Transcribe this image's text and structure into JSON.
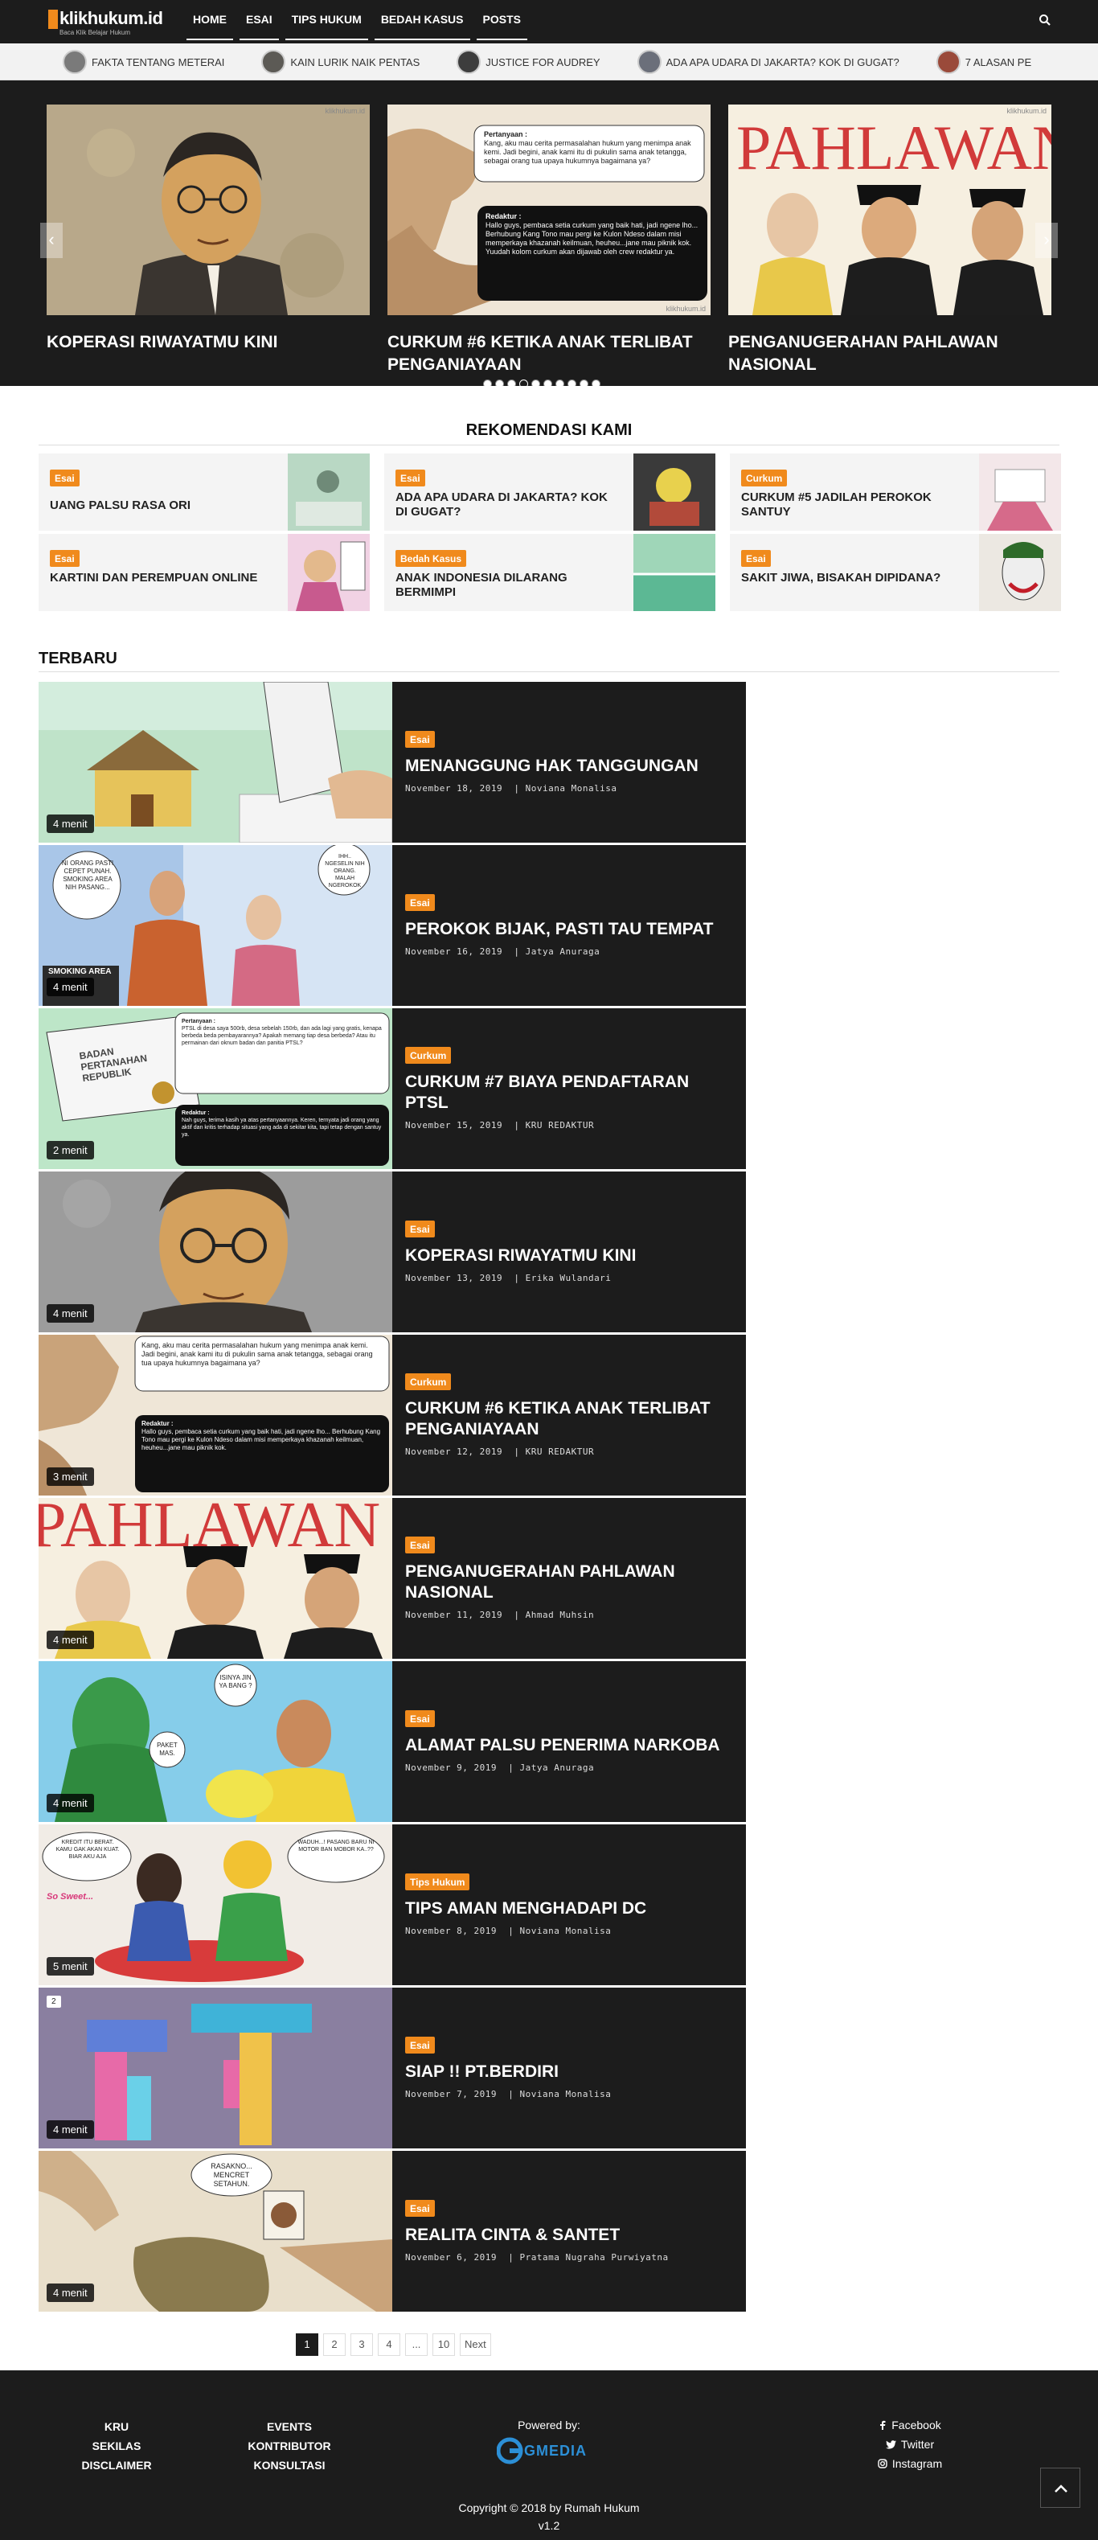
{
  "brand": {
    "logo": "klikhukum.id",
    "tagline": "Baca Klik Belajar Hukum",
    "accent": "#f08a1c",
    "dark": "#1c1c1c"
  },
  "nav": {
    "items": [
      "HOME",
      "ESAI",
      "TIPS HUKUM",
      "BEDAH KASUS",
      "POSTS"
    ],
    "search_icon": "search-icon"
  },
  "ticker": {
    "items": [
      "Fakta Tentang Meterai",
      "Kain Lurik Naik Pentas",
      "Justice for Audrey",
      "Ada Apa Udara di Jakarta? Kok di Gugat?",
      "7 Alasan Pe"
    ]
  },
  "slider": {
    "watermark": "klikhukum.id",
    "slides": [
      {
        "title": "Koperasi Riwayatmu Kini"
      },
      {
        "title": "Curkum #6 Ketika Anak Terlibat Penganiayaan",
        "q_label": "Pertanyaan :",
        "q_text": "Kang, aku mau cerita permasalahan hukum yang menimpa anak kemi. Jadi begini, anak kami itu di pukulin sama anak tetangga, sebagai orang tua upaya hukumnya bagaimana ya?",
        "a_label": "Redaktur :",
        "a_text": "Hallo guys, pembaca setia curkum yang baik hati, jadi ngene lho... Berhubung Kang Tono mau pergi ke Kulon Ndeso dalam misi memperkaya khazanah keilmuan, heuheu...jane mau piknik kok. Yuudah kolom curkum akan dijawab oleh crew redaktur ya."
      },
      {
        "title": "Penganugerahan Pahlawan Nasional",
        "art_text": "PAHLAWAN"
      }
    ],
    "dots": 10,
    "active_dot": 4,
    "prev_icon": "chevron-left-icon",
    "next_icon": "chevron-right-icon"
  },
  "rekomendasi": {
    "title": "Rekomendasi Kami",
    "items": [
      {
        "badge": "Esai",
        "title": "Uang Palsu Rasa Ori"
      },
      {
        "badge": "Esai",
        "title": "Ada Apa Udara di Jakarta? Kok di Gugat?"
      },
      {
        "badge": "Curkum",
        "title": "Curkum #5 Jadilah Perokok Santuy"
      },
      {
        "badge": "Esai",
        "title": "Kartini dan Perempuan Online"
      },
      {
        "badge": "Bedah Kasus",
        "title": "Anak Indonesia Dilarang Bermimpi"
      },
      {
        "badge": "Esai",
        "title": "Sakit Jiwa, Bisakah Dipidana?"
      }
    ]
  },
  "terbaru": {
    "title": "Terbaru",
    "posts": [
      {
        "badge": "Esai",
        "title": "Menanggung Hak Tanggungan",
        "date": "November 18, 2019",
        "author": "Noviana Monalisa",
        "read": "4 menit"
      },
      {
        "badge": "Esai",
        "title": "Perokok Bijak, Pasti Tau Tempat",
        "date": "November 16, 2019",
        "author": "Jatya Anuraga",
        "read": "4 menit",
        "bubble1": "NI ORANG PASTI CEPET PUNAH. SMOKING AREA NIH PASANG...",
        "bubble2": "IHH.. NGESELIN NIH ORANG. MALAH NGEROKOK",
        "sign": "SMOKING AREA"
      },
      {
        "badge": "Curkum",
        "title": "Curkum #7 Biaya Pendaftaran PTSL",
        "date": "November 15, 2019",
        "author": "KRU REDAKTUR",
        "read": "2 menit",
        "q_label": "Pertanyaan :",
        "q_text": "PTSL di desa saya 500rb, desa sebelah 150rb, dan ada lagi yang gratis, kenapa berbeda beda pembayarannya? Apakah memang tiap desa berbeda? Atau itu permainan dari oknum badan dan panitia PTSL?",
        "a_label": "Redaktur :",
        "a_text": "Nah guys, terima kasih ya atas pertanyaannya. Keren, ternyata jadi orang yang aktif dan kritis terhadap situasi yang ada di sekitar kita, tapi tetap dengan santuy ya.",
        "sign": "BADAN PERTANAHAN REPUBLIK"
      },
      {
        "badge": "Esai",
        "title": "Koperasi Riwayatmu Kini",
        "date": "November 13, 2019",
        "author": "Erika Wulandari",
        "read": "4 menit"
      },
      {
        "badge": "Curkum",
        "title": "Curkum #6 Ketika Anak Terlibat Penganiayaan",
        "date": "November 12, 2019",
        "author": "KRU REDAKTUR",
        "read": "3 menit",
        "q_text": "Kang, aku mau cerita permasalahan hukum yang menimpa anak kemi. Jadi begini, anak kami itu di pukulin sama anak tetangga, sebagai orang tua upaya hukumnya bagaimana ya?",
        "a_label": "Redaktur :",
        "a_text": "Hallo guys, pembaca setia curkum yang baik hati, jadi ngene lho... Berhubung Kang Tono mau pergi ke Kulon Ndeso dalam misi memperkaya khazanah keilmuan, heuheu...jane mau piknik kok."
      },
      {
        "badge": "Esai",
        "title": "Penganugerahan Pahlawan Nasional",
        "date": "November 11, 2019",
        "author": "Ahmad Muhsin",
        "read": "4 menit",
        "art_text": "PAHLAWAN"
      },
      {
        "badge": "Esai",
        "title": "Alamat Palsu Penerima Narkoba",
        "date": "November 9, 2019",
        "author": "Jatya Anuraga",
        "read": "4 menit",
        "bubble1": "ISINYA JIN YA BANG ?",
        "bubble2": "PAKET MAS."
      },
      {
        "badge": "Tips Hukum",
        "title": "Tips Aman Menghadapi DC",
        "date": "November 8, 2019",
        "author": "Noviana Monalisa",
        "read": "5 menit",
        "bubble1": "KREDIT ITU BERAT. KAMU GAK AKAN KUAT. BIAR AKU AJA",
        "bubble2": "WADUH...! PASANG BARU NI MOTOR BAN MOBOR KA..??",
        "caption": "So Sweet..."
      },
      {
        "badge": "Esai",
        "title": "Siap !! PT.Berdiri",
        "date": "November 7, 2019",
        "author": "Noviana Monalisa",
        "read": "4 menit",
        "counter": "2"
      },
      {
        "badge": "Esai",
        "title": "Realita Cinta & Santet",
        "date": "November 6, 2019",
        "author": "Pratama Nugraha Purwiyatna",
        "read": "4 menit",
        "bubble1": "RASAKNO... MENCRET SETAHUN."
      }
    ]
  },
  "pagination": {
    "pages": [
      "1",
      "2",
      "3",
      "4",
      "...",
      "10"
    ],
    "active": "1",
    "next": "Next"
  },
  "footer": {
    "col1": [
      "KRU",
      "SEKILAS",
      "DISCLAIMER"
    ],
    "col2": [
      "EVENTS",
      "KONTRIBUTOR",
      "KONSULTASI"
    ],
    "powered": "Powered by:",
    "gmedia": "GMEDIA",
    "social": [
      {
        "label": "Facebook",
        "icon": "facebook-icon"
      },
      {
        "label": "Twitter",
        "icon": "twitter-icon"
      },
      {
        "label": "Instagram",
        "icon": "instagram-icon"
      }
    ],
    "copyright": "Copyright © 2018 by Rumah Hukum",
    "version": "v1.2",
    "to_top_icon": "chevron-up-icon"
  }
}
